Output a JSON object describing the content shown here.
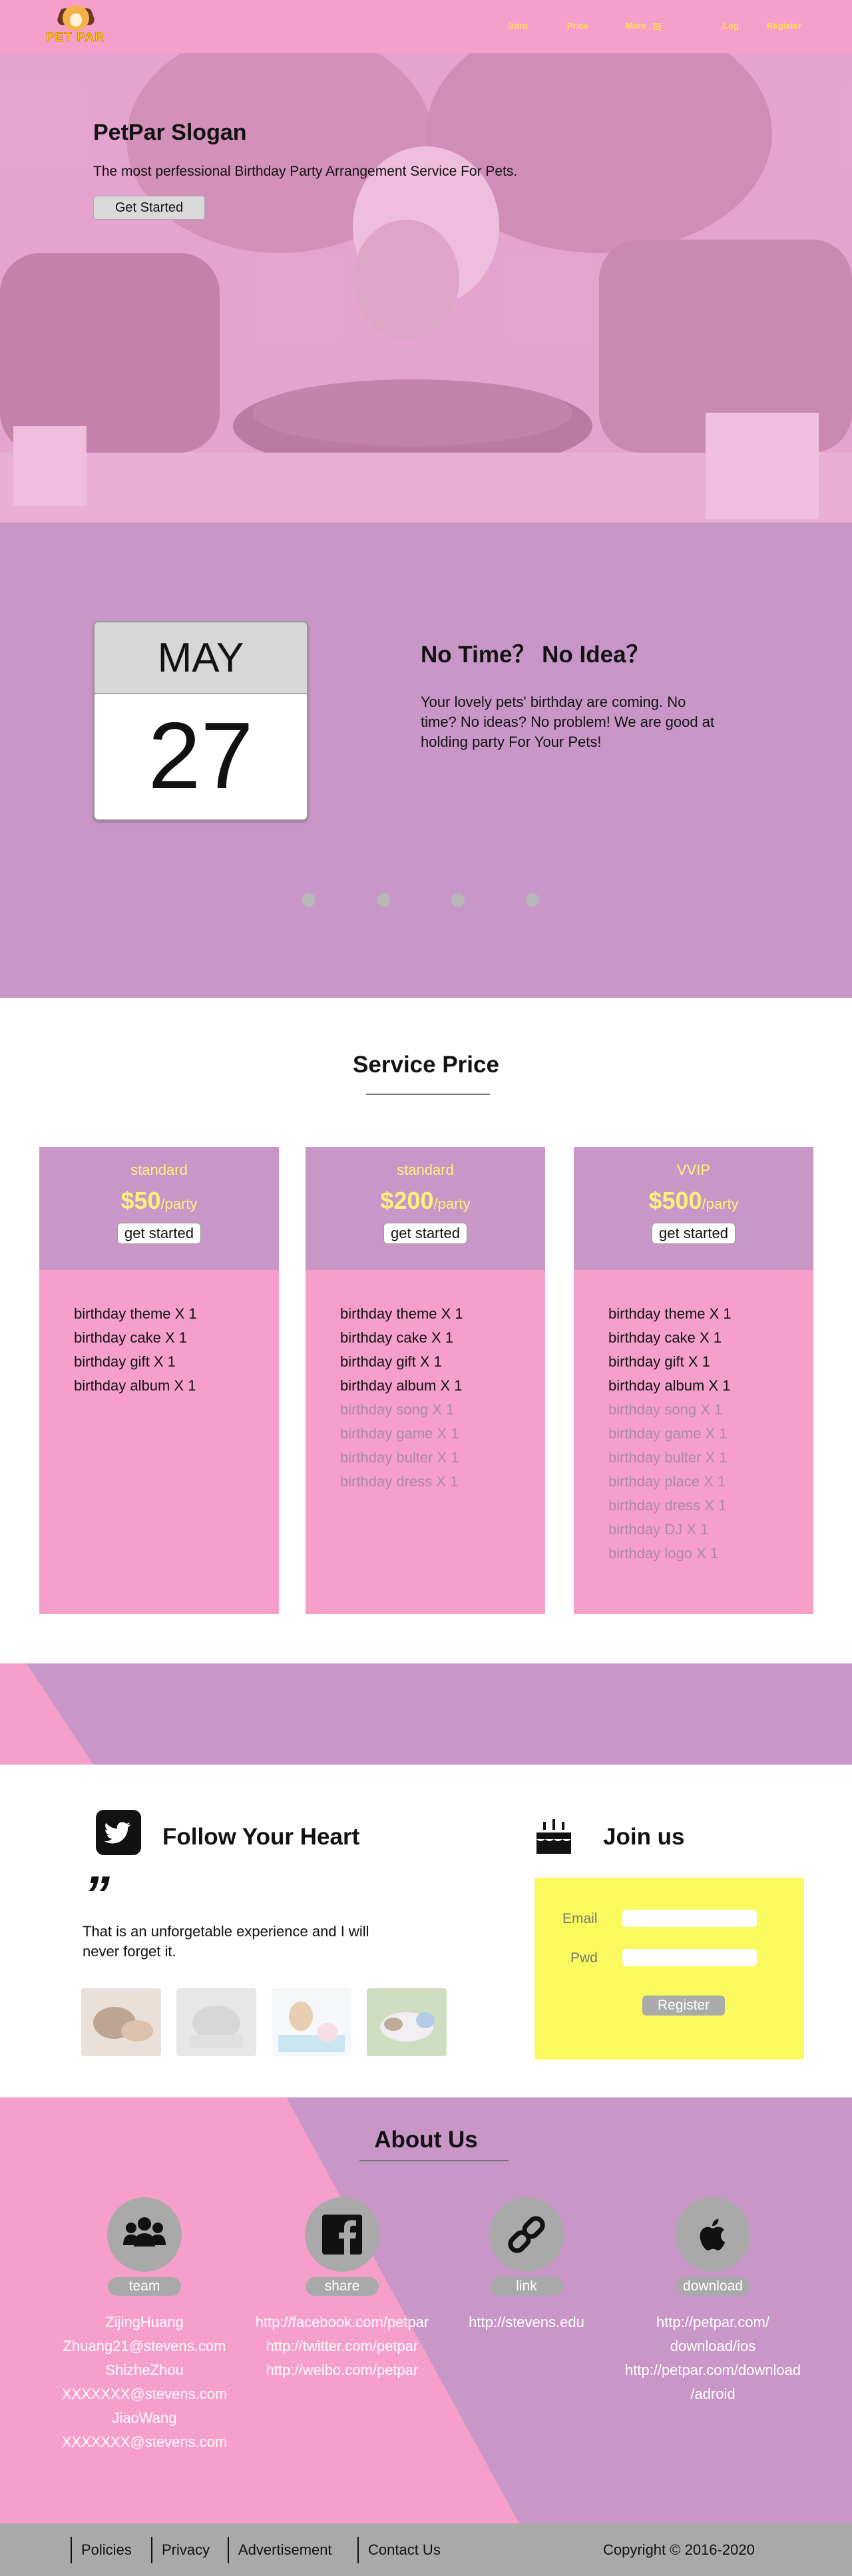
{
  "nav": {
    "logo_text": "PET PAR",
    "links": [
      "Intro",
      "Price",
      "More",
      "Log",
      "Register"
    ]
  },
  "hero": {
    "title": "PetPar Slogan",
    "subtitle": "The most perfessional Birthday Party Arrangement Service For Pets.",
    "button": "Get Started"
  },
  "carousel": {
    "month": "MAY",
    "day": "27",
    "title": "No Time？ No Idea？",
    "text": "Your lovely pets' birthday are coming. No time? No ideas? No problem! We are good at holding party For Your Pets!",
    "dot_count": 4
  },
  "pricing": {
    "heading": "Service Price",
    "plans": [
      {
        "tier": "standard",
        "price": "$50",
        "unit": "/party",
        "button": "get started",
        "included": [
          "birthday theme X 1",
          "birthday cake X 1",
          "birthday gift X 1",
          "birthday album X 1"
        ],
        "extra": []
      },
      {
        "tier": "standard",
        "price": "$200",
        "unit": "/party",
        "button": "get started",
        "included": [
          "birthday theme X 1",
          "birthday cake X 1",
          "birthday gift X 1",
          "birthday album X 1"
        ],
        "extra": [
          "birthday song X 1",
          "birthday game X 1",
          "birthday bulter X 1",
          "birthday dress X 1"
        ]
      },
      {
        "tier": "VVIP",
        "price": "$500",
        "unit": "/party",
        "button": "get started",
        "included": [
          "birthday theme X 1",
          "birthday cake X 1",
          "birthday gift X 1",
          "birthday album X 1"
        ],
        "extra": [
          "birthday song X 1",
          "birthday game X 1",
          "birthday bulter X 1",
          "birthday place X 1",
          "birthday dress X 1",
          "birthday DJ X 1",
          "birthday logo X 1"
        ]
      }
    ]
  },
  "follow": {
    "title": "Follow Your Heart",
    "quote_mark": "”",
    "quote": "That is an unforgetable experience and I will never forget it."
  },
  "join": {
    "title": "Join us",
    "email_label": "Email",
    "pwd_label": "Pwd",
    "button": "Register"
  },
  "about": {
    "title": "About Us",
    "columns": [
      {
        "tag": "team",
        "icon": "team-icon",
        "lines": [
          "ZijingHuang",
          "Zhuang21@stevens.com",
          "ShizheZhou",
          "XXXXXXX@stevens.com",
          "JiaoWang",
          "XXXXXXX@stevens.com"
        ]
      },
      {
        "tag": "share",
        "icon": "facebook-icon",
        "lines": [
          "http://facebook.com/petpar",
          "http://twitter.com/petpar",
          "http://weibo.com/petpar"
        ]
      },
      {
        "tag": "link",
        "icon": "link-icon",
        "lines": [
          "http://stevens.edu"
        ]
      },
      {
        "tag": "download",
        "icon": "apple-icon",
        "lines": [
          "http://petpar.com/",
          "download/ios",
          "http://petpar.com/download",
          "/adroid"
        ]
      }
    ]
  },
  "footer": {
    "links": [
      "Policies",
      "Privacy",
      "Advertisement",
      "Contact Us"
    ],
    "copyright": "Copyright © 2016-2020"
  },
  "colors": {
    "pink": "#f79fcb",
    "purple": "#c897c8",
    "yellow": "#fafa5e",
    "price_yellow": "#fff27a",
    "grey": "#a9a9a9"
  }
}
